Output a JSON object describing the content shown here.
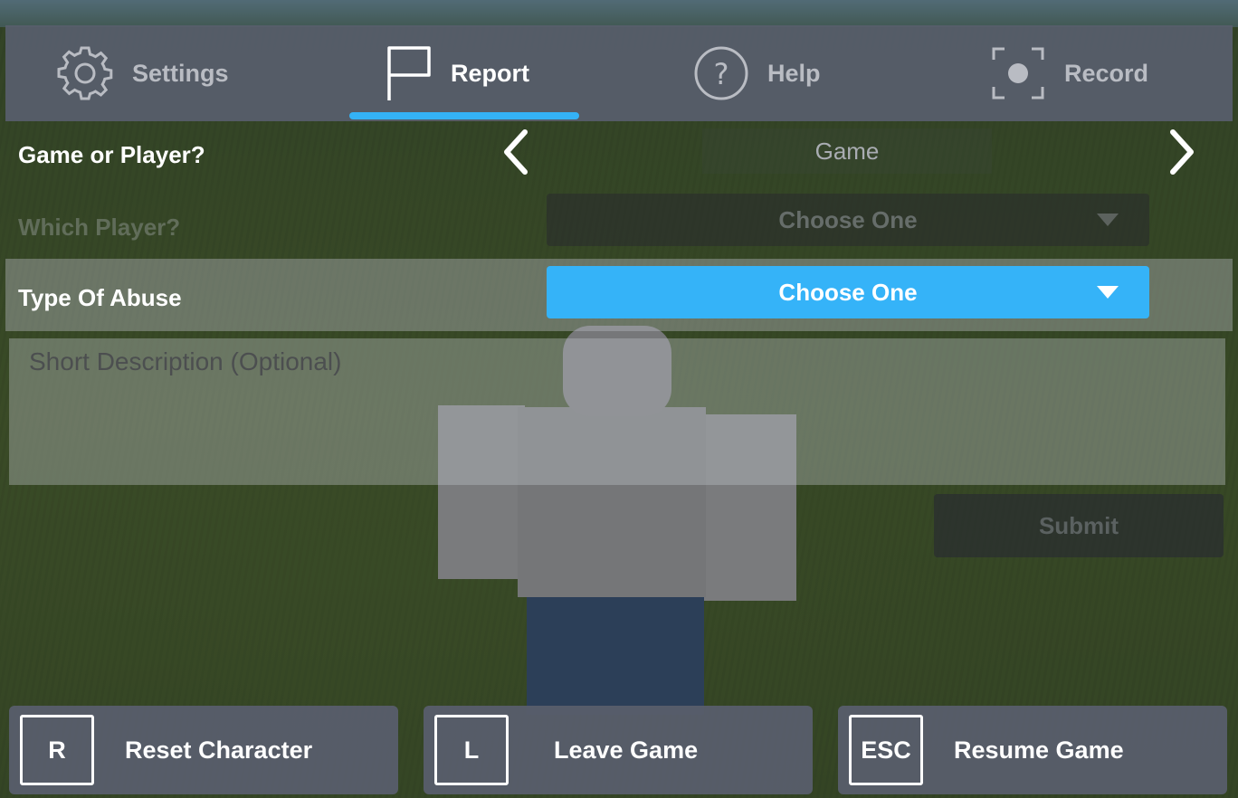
{
  "tabs": [
    {
      "label": "Settings",
      "icon": "gear-icon",
      "active": false
    },
    {
      "label": "Report",
      "icon": "flag-icon",
      "active": true
    },
    {
      "label": "Help",
      "icon": "help-icon",
      "active": false
    },
    {
      "label": "Record",
      "icon": "record-icon",
      "active": false
    }
  ],
  "report": {
    "game_or_player_label": "Game or Player?",
    "game_or_player_value": "Game",
    "which_player_label": "Which Player?",
    "which_player_value": "Choose One",
    "type_of_abuse_label": "Type Of Abuse",
    "type_of_abuse_value": "Choose One",
    "description_placeholder": "Short Description (Optional)",
    "submit_label": "Submit"
  },
  "bottom_buttons": [
    {
      "key": "R",
      "label": "Reset Character"
    },
    {
      "key": "L",
      "label": "Leave Game"
    },
    {
      "key": "ESC",
      "label": "Resume Game"
    }
  ],
  "colors": {
    "accent": "#35b3f8",
    "tab_bar": "#585e6c",
    "text": "#ffffff"
  }
}
